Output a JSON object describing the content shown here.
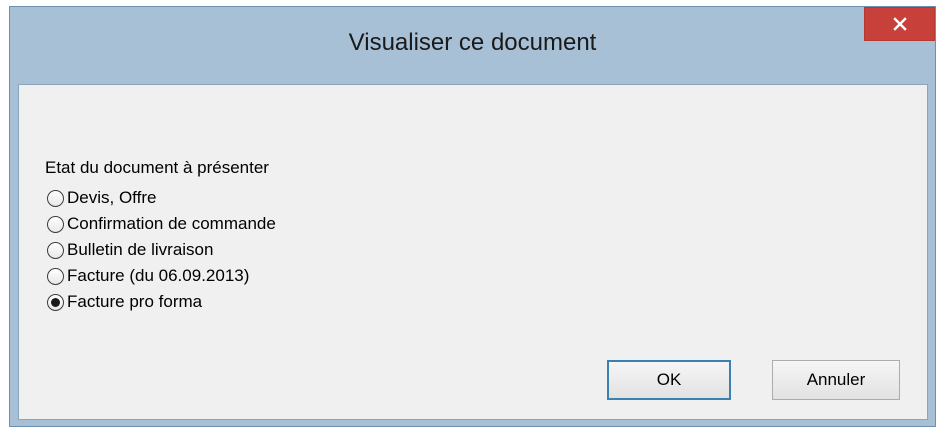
{
  "window": {
    "title": "Visualiser ce document"
  },
  "icons": {
    "close": "close-icon"
  },
  "colors": {
    "title_bar": "#a8c0d6",
    "close_button": "#c7413a",
    "client_background": "#f0f0f0",
    "default_button_border": "#3c7fb1"
  },
  "group": {
    "label": "Etat du document à présenter",
    "options": [
      {
        "label": "Devis, Offre",
        "checked": false
      },
      {
        "label": "Confirmation de commande",
        "checked": false
      },
      {
        "label": "Bulletin de livraison",
        "checked": false
      },
      {
        "label": "Facture (du 06.09.2013)",
        "checked": false
      },
      {
        "label": "Facture pro forma",
        "checked": true
      }
    ]
  },
  "buttons": {
    "ok_label": "OK",
    "cancel_label": "Annuler"
  }
}
